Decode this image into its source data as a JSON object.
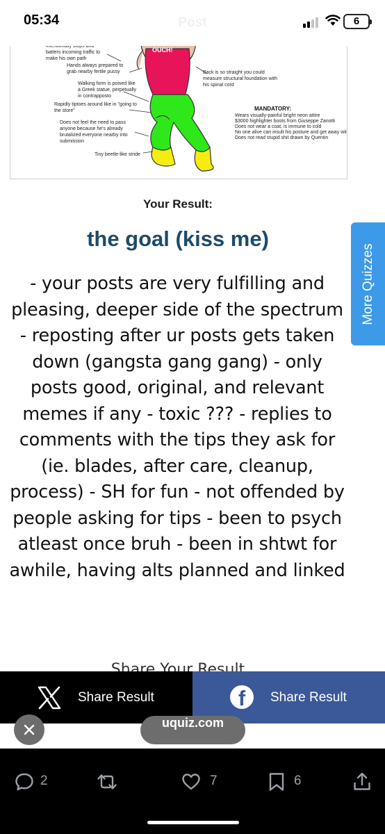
{
  "status_bar": {
    "time": "05:34",
    "screen_title": "Post",
    "battery": "6"
  },
  "meme": {
    "shirt_text": "OUCH!",
    "annotations": {
      "traffic": "intentionally stops and batters incoming traffic to make his own path",
      "hands": "Hands always prepared to grab nearby fertile pussy",
      "walking": "Walking form is poised like a Greek statue, perpetually in contrapposto",
      "tiptoes": "Rapidly tiptoes around like in \"going to the store\"",
      "pass": "Does not feel the need to pass anyone because he's already brutalized everyone nearby into submission",
      "stride": "Tiny beetle-like stride",
      "back": "Back is so straight you could measure structural foundation with his spinal cord"
    },
    "mandatory_title": "MANDATORY:",
    "mandatory_items": [
      "Wears visually-painful bright neon attire",
      "$3000 highlighter boots from Giuseppe Zanotti",
      "Does not wear a coat, is immune to cold",
      "No one alive can insult his posture and get away with it",
      "Does not read stupid shit drawn by Quentin"
    ]
  },
  "result": {
    "heading": "Your Result:",
    "title": "the goal (kiss me)",
    "description": "- your posts are very fulfilling and pleasing, deeper side of the spectrum - reposting after ur posts gets taken down (gangsta gang gang) - only posts good, original, and relevant memes if any - toxic ??? - replies to comments with the tips they ask for (ie. blades, after care, cleanup, process) - SH for fun - not offended by people asking for tips - been to psych atleast once bruh - been in shtwt for awhile, having alts planned and linked",
    "share_heading": "Share Your Result"
  },
  "more_quizzes": "More Quizzes",
  "share_bar": {
    "x_label": "Share Result",
    "facebook_label": "Share Result"
  },
  "ad": {
    "domain": "uquiz.com"
  },
  "actions": {
    "replies": "2",
    "reposts": "",
    "likes": "7",
    "bookmarks": "6"
  },
  "colors": {
    "result_title": "#1e4a6b",
    "more_quizzes_bg": "#3d9ae8",
    "facebook_bg": "#3b5998",
    "shirt": "#e8145a",
    "pants": "#2ee81a",
    "boots": "#f5ec10"
  },
  "icons": [
    "signal-icon",
    "wifi-icon",
    "x-logo-icon",
    "facebook-logo-icon",
    "close-icon",
    "reply-icon",
    "repost-icon",
    "like-icon",
    "bookmark-icon",
    "share-icon"
  ]
}
